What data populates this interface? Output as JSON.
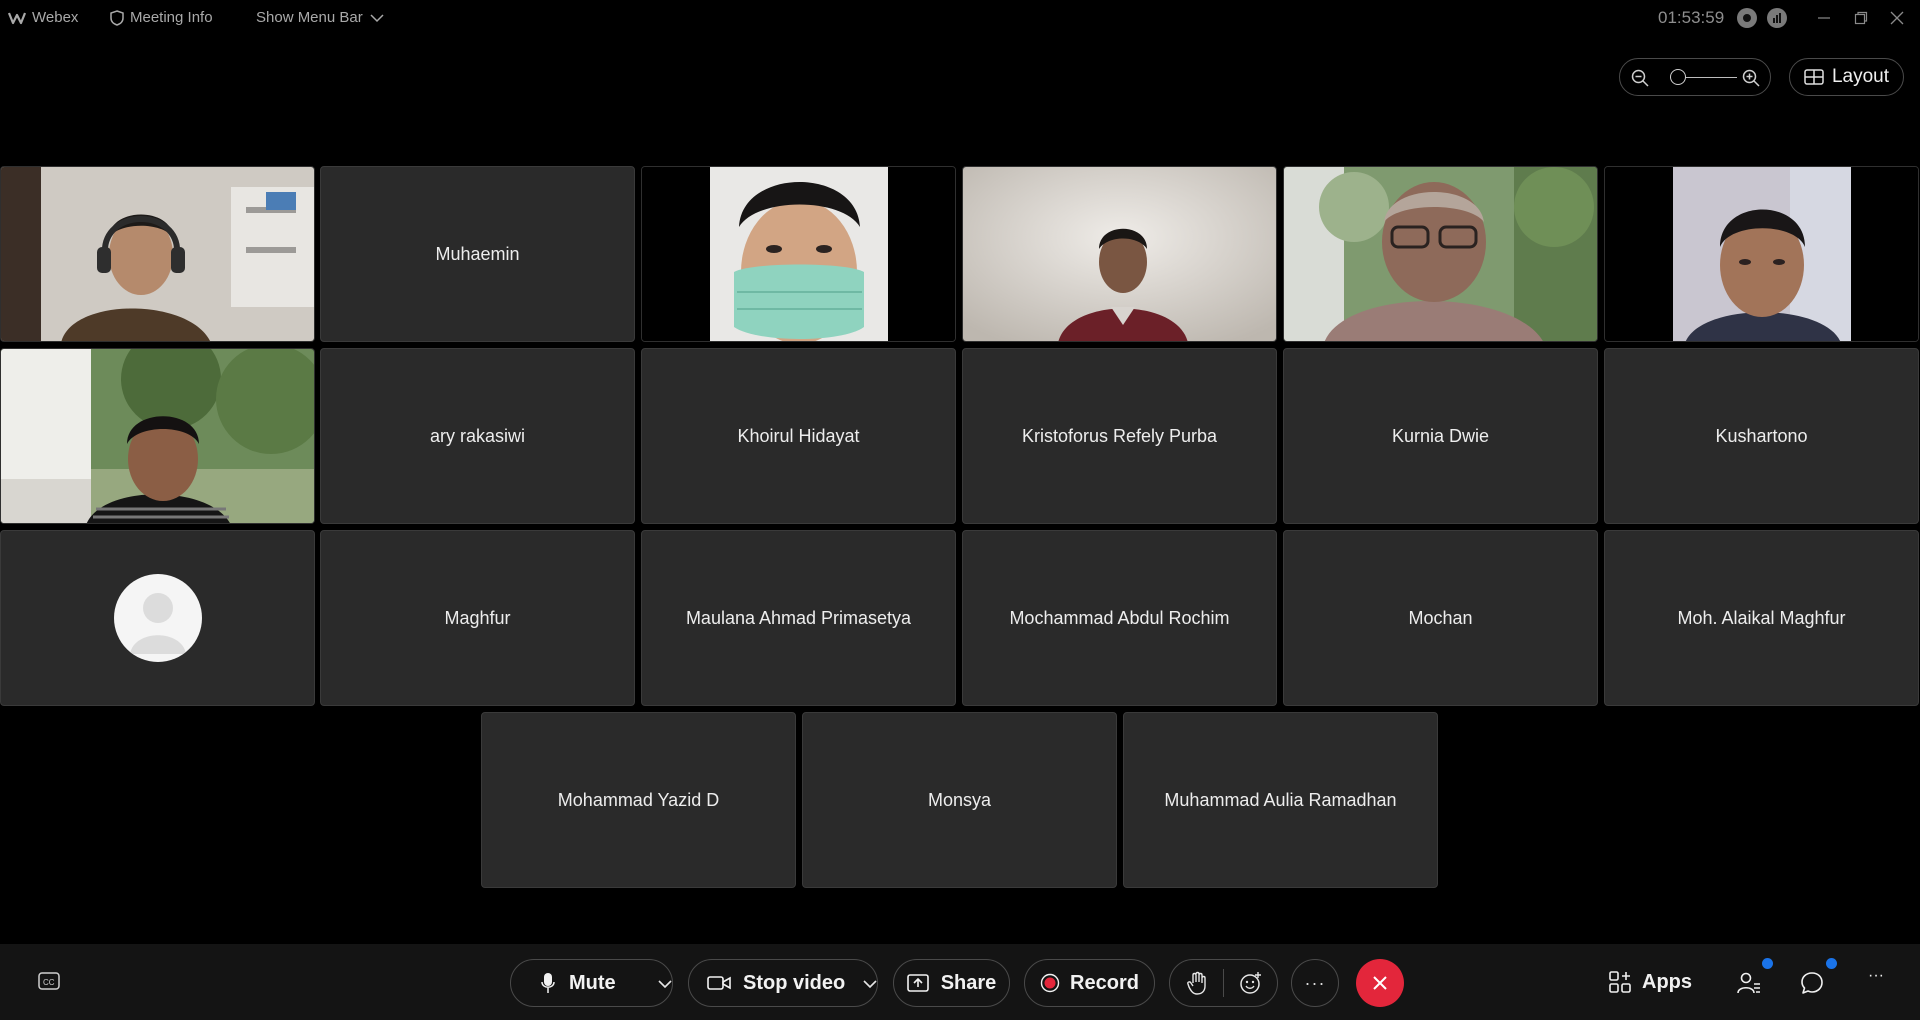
{
  "titlebar": {
    "app_name": "Webex",
    "meeting_info": "Meeting Info",
    "show_menu_bar": "Show Menu Bar",
    "clock": "01:53:59"
  },
  "view_controls": {
    "zoom_level": 0.1,
    "layout_label": "Layout"
  },
  "participants": [
    {
      "name": "",
      "video": true,
      "scene": "headphones-indoor"
    },
    {
      "name": "Muhaemin",
      "video": false
    },
    {
      "name": "",
      "video": true,
      "scene": "mask"
    },
    {
      "name": "",
      "video": true,
      "scene": "white-wall"
    },
    {
      "name": "",
      "video": true,
      "scene": "blurred-forest"
    },
    {
      "name": "",
      "video": true,
      "scene": "portrait-car"
    },
    {
      "name": "",
      "video": true,
      "scene": "forest-room"
    },
    {
      "name": "ary rakasiwi",
      "video": false
    },
    {
      "name": "Khoirul Hidayat",
      "video": false
    },
    {
      "name": "Kristoforus Refely Purba",
      "video": false
    },
    {
      "name": "Kurnia Dwie",
      "video": false
    },
    {
      "name": "Kushartono",
      "video": false
    },
    {
      "name": "",
      "video": false,
      "avatar": true
    },
    {
      "name": "Maghfur",
      "video": false
    },
    {
      "name": "Maulana Ahmad Primasetya",
      "video": false
    },
    {
      "name": "Mochammad Abdul Rochim",
      "video": false
    },
    {
      "name": "Mochan",
      "video": false
    },
    {
      "name": "Moh. Alaikal Maghfur",
      "video": false
    },
    {
      "name": "Mohammad Yazid D",
      "video": false
    },
    {
      "name": "Monsya",
      "video": false
    },
    {
      "name": "Muhammad Aulia Ramadhan",
      "video": false
    }
  ],
  "toolbar": {
    "mute_label": "Mute",
    "stop_video_label": "Stop video",
    "share_label": "Share",
    "record_label": "Record",
    "apps_label": "Apps",
    "more_label": "···",
    "overflow_label": "···"
  },
  "colors": {
    "end_call": "#e3263b",
    "record_dot": "#e3263b",
    "notification_dot": "#1a73e8",
    "tile_bg": "#2a2a2a"
  }
}
